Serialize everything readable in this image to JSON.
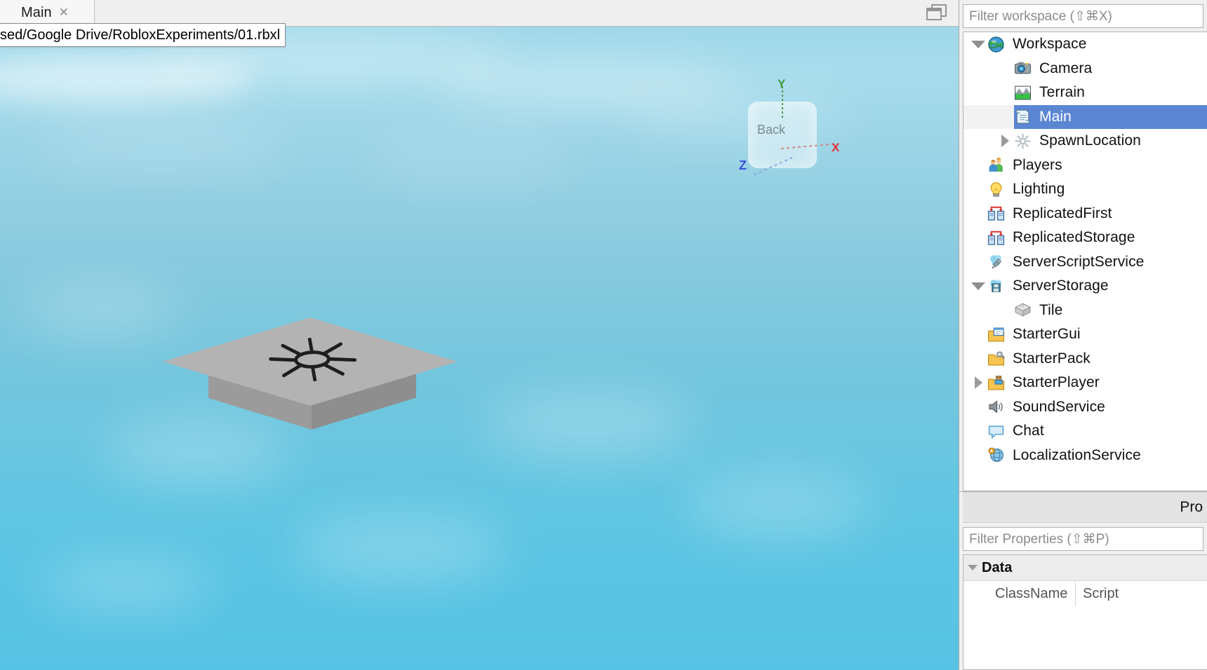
{
  "window": {
    "app": "Roblox Studio"
  },
  "tab_bar": {
    "tabs": [
      {
        "label": "Main",
        "close_label": "✕",
        "active": true
      }
    ],
    "restore_icon": "window-restore-icon"
  },
  "path_tooltip": {
    "text": "sed/Google Drive/RobloxExperiments/01.rbxl"
  },
  "viewport": {
    "view_cube": {
      "face_label": "Back",
      "axes": [
        {
          "name": "Y",
          "label": "Y",
          "color": "#3d9b3d"
        },
        {
          "name": "X",
          "label": "X",
          "color": "#e03030"
        },
        {
          "name": "Z",
          "label": "Z",
          "color": "#3b52d8"
        }
      ]
    },
    "part": {
      "name": "Tile",
      "decal": "sun-star-decal",
      "top_color": "#b3b3b3",
      "side_color": "#9b9b9b"
    },
    "sky_top_color": "#9fd8ea",
    "sky_bottom_color": "#57c3e4"
  },
  "explorer": {
    "filter": {
      "placeholder": "Filter workspace (⇧⌘X)",
      "value": ""
    },
    "selection_color": "#5b86d4",
    "rows": [
      {
        "label": "Workspace",
        "icon": "globe-icon",
        "depth": 0,
        "twisty": "down",
        "selected": false
      },
      {
        "label": "Camera",
        "icon": "camera-icon",
        "depth": 1,
        "twisty": "none",
        "selected": false
      },
      {
        "label": "Terrain",
        "icon": "terrain-icon",
        "depth": 1,
        "twisty": "none",
        "selected": false
      },
      {
        "label": "Main",
        "icon": "script-icon",
        "depth": 1,
        "twisty": "none",
        "selected": true
      },
      {
        "label": "SpawnLocation",
        "icon": "spawnlocation-icon",
        "depth": 1,
        "twisty": "right",
        "selected": false
      },
      {
        "label": "Players",
        "icon": "players-icon",
        "depth": 0,
        "twisty": "none",
        "selected": false
      },
      {
        "label": "Lighting",
        "icon": "lightbulb-icon",
        "depth": 0,
        "twisty": "none",
        "selected": false
      },
      {
        "label": "ReplicatedFirst",
        "icon": "replication-icon",
        "depth": 0,
        "twisty": "none",
        "selected": false
      },
      {
        "label": "ReplicatedStorage",
        "icon": "replication-icon",
        "depth": 0,
        "twisty": "none",
        "selected": false
      },
      {
        "label": "ServerScriptService",
        "icon": "server-script-icon",
        "depth": 0,
        "twisty": "none",
        "selected": false
      },
      {
        "label": "ServerStorage",
        "icon": "server-storage-icon",
        "depth": 0,
        "twisty": "down",
        "selected": false
      },
      {
        "label": "Tile",
        "icon": "part-brick-icon",
        "depth": 1,
        "twisty": "none",
        "selected": false
      },
      {
        "label": "StarterGui",
        "icon": "starter-gui-icon",
        "depth": 0,
        "twisty": "none",
        "selected": false
      },
      {
        "label": "StarterPack",
        "icon": "starter-pack-icon",
        "depth": 0,
        "twisty": "none",
        "selected": false
      },
      {
        "label": "StarterPlayer",
        "icon": "starter-player-icon",
        "depth": 0,
        "twisty": "right",
        "selected": false
      },
      {
        "label": "SoundService",
        "icon": "speaker-icon",
        "depth": 0,
        "twisty": "none",
        "selected": false
      },
      {
        "label": "Chat",
        "icon": "chat-bubble-icon",
        "depth": 0,
        "twisty": "none",
        "selected": false
      },
      {
        "label": "LocalizationService",
        "icon": "localization-icon",
        "depth": 0,
        "twisty": "none",
        "selected": false
      }
    ]
  },
  "properties": {
    "title": "Pro",
    "filter": {
      "placeholder": "Filter Properties (⇧⌘P)",
      "value": ""
    },
    "groups": [
      {
        "label": "Data",
        "expanded": true,
        "rows": [
          {
            "name": "ClassName",
            "value": "Script"
          }
        ]
      }
    ]
  }
}
